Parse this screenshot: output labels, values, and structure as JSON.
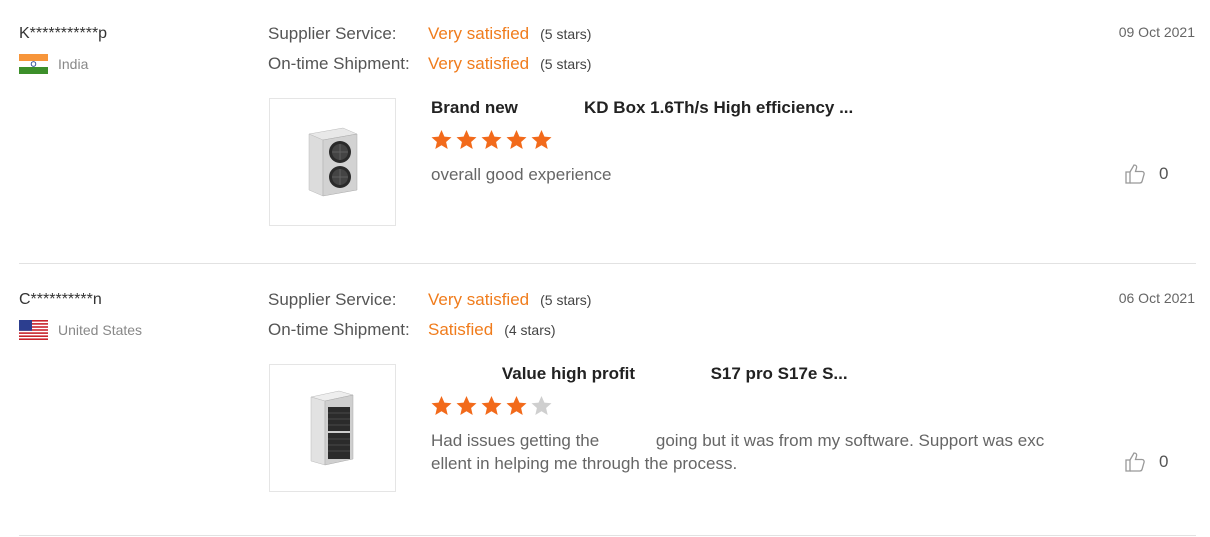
{
  "colors": {
    "accent": "#f07c1c",
    "star_filled": "#f26a1b",
    "star_empty": "#cfcfcf",
    "divider": "#e2e2e2"
  },
  "labels": {
    "supplier_service": "Supplier Service:",
    "on_time_shipment": "On-time Shipment:"
  },
  "reviews": [
    {
      "user": "K***********p",
      "country": "India",
      "flag_icon": "india-flag-icon",
      "date": "09 Oct 2021",
      "supplier_service": {
        "value": "Very satisfied",
        "stars_text": "(5 stars)"
      },
      "on_time_shipment": {
        "value": "Very satisfied",
        "stars_text": "(5 stars)"
      },
      "product_title": "Brand new              KD Box 1.6Th/s High efficiency ...",
      "rating": 5,
      "text": "overall good experience",
      "likes": "0",
      "thumb_icon": "asic-miner-kdbox-image"
    },
    {
      "user": "C**********n",
      "country": "United States",
      "flag_icon": "usa-flag-icon",
      "date": "06 Oct 2021",
      "supplier_service": {
        "value": "Very satisfied",
        "stars_text": "(5 stars)"
      },
      "on_time_shipment": {
        "value": "Satisfied",
        "stars_text": "(4 stars)"
      },
      "product_title": "               Value high profit                S17 pro S17e S...",
      "rating": 4,
      "text": "Had issues getting the            going but it was from my software. Support was exc ellent in helping me through the process.",
      "likes": "0",
      "thumb_icon": "asic-miner-s17-image"
    }
  ]
}
